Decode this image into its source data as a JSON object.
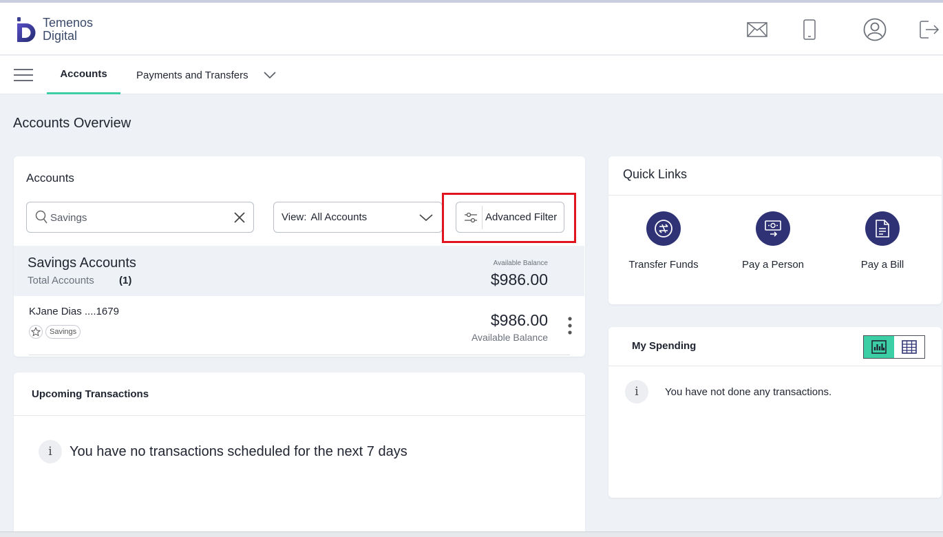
{
  "app": {
    "logo_line1": "Temenos",
    "logo_line2": "Digital",
    "brand_color": "#2f3375",
    "accent_color": "#3ccfa6",
    "highlight_color": "#e0141e"
  },
  "header": {
    "icons": [
      "mail-icon",
      "mobile-icon",
      "user-profile-icon",
      "logout-icon"
    ]
  },
  "nav": {
    "menu_icon": "hamburger-icon",
    "tabs": [
      {
        "label": "Accounts",
        "active": true
      },
      {
        "label": "Payments and Transfers",
        "active": false
      }
    ]
  },
  "page": {
    "title": "Accounts Overview"
  },
  "accounts_card": {
    "title": "Accounts",
    "search": {
      "value": "Savings",
      "placeholder": "Search"
    },
    "view_select": {
      "label": "View:",
      "value": "All Accounts"
    },
    "advanced_filter_label": "Advanced Filter",
    "group": {
      "name": "Savings Accounts",
      "total_label": "Total Accounts",
      "total_count": "(1)",
      "balance_caption": "Available Balance",
      "balance": "$986.00"
    },
    "accounts": [
      {
        "name": "KJane Dias ....1679",
        "tag": "Savings",
        "balance": "$986.00",
        "balance_label": "Available Balance"
      }
    ]
  },
  "upcoming": {
    "title": "Upcoming Transactions",
    "message": "You have no transactions scheduled for the next 7 days"
  },
  "quick_links": {
    "title": "Quick Links",
    "items": [
      {
        "label": "Transfer Funds",
        "icon": "transfer-icon"
      },
      {
        "label": "Pay a Person",
        "icon": "pay-person-icon"
      },
      {
        "label": "Pay a Bill",
        "icon": "bill-icon"
      }
    ]
  },
  "spending": {
    "title": "My Spending",
    "message": "You have not done any transactions.",
    "view_toggle": [
      "chart-view-icon",
      "table-view-icon"
    ]
  }
}
